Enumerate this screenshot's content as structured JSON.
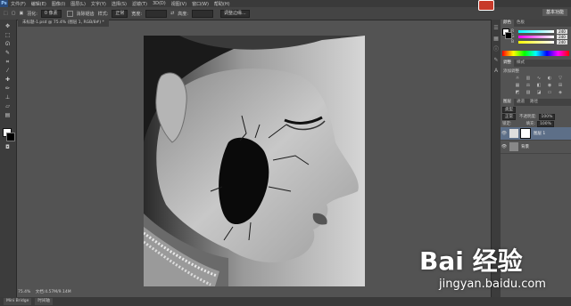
{
  "app": {
    "logo": "Ps"
  },
  "menubar": {
    "items": [
      "文件(F)",
      "编辑(E)",
      "图像(I)",
      "图层(L)",
      "文字(Y)",
      "选择(S)",
      "滤镜(T)",
      "3D(D)",
      "视图(V)",
      "窗口(W)",
      "帮助(H)"
    ]
  },
  "options": {
    "feather_label": "羽化:",
    "feather_value": "0 像素",
    "antialias_label": "消除锯齿",
    "style_label": "样式:",
    "style_value": "正常",
    "width_label": "宽度:",
    "height_label": "高度:",
    "refine_label": "调整边缘..."
  },
  "workspace": {
    "label": "基本功能"
  },
  "document": {
    "tab_title": "未标题-1.psd @ 75.4% (图层 1, RGB/8#) *",
    "zoom": "75.4%",
    "doc_info": "文档:4.57M/9.14M"
  },
  "bottom_tabs": [
    "Mini Bridge",
    "时间轴"
  ],
  "panels": {
    "color": {
      "tabs": [
        "颜色",
        "色板"
      ],
      "r": "240",
      "g": "240",
      "b": "240",
      "labels": [
        "R",
        "G",
        "B"
      ]
    },
    "adjustments": {
      "tabs": [
        "调整",
        "样式"
      ],
      "title": "添加调整"
    },
    "layers": {
      "tabs": [
        "图层",
        "通道",
        "路径"
      ],
      "kind_label": "类型",
      "blend_mode": "正常",
      "opacity_label": "不透明度:",
      "opacity": "100%",
      "lock_label": "锁定:",
      "fill_label": "填充:",
      "fill": "100%",
      "items": [
        {
          "name": "图层 1",
          "selected": true
        },
        {
          "name": "背景",
          "selected": false
        }
      ]
    }
  },
  "watermark": {
    "brand": "Bai 经验",
    "url": "jingyan.baidu.com"
  },
  "colors": {
    "accent_red": "#c83a2a",
    "selected_layer": "#5d6f88"
  }
}
